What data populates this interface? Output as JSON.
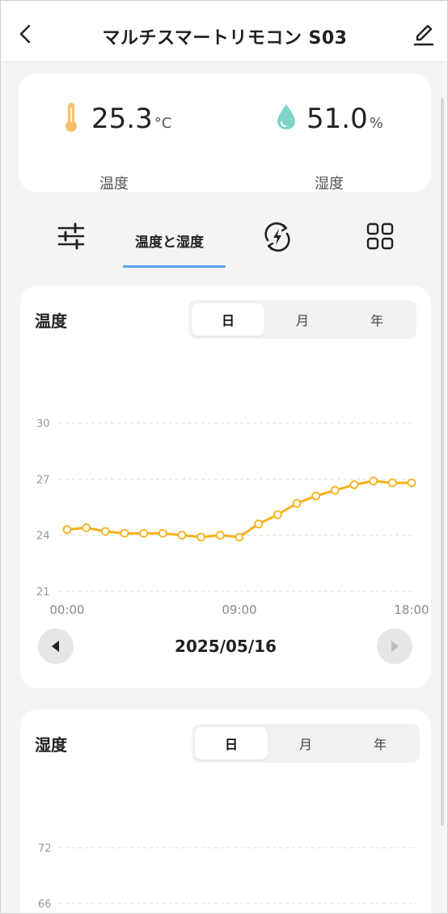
{
  "header": {
    "title": "マルチスマートリモコン S03",
    "back_icon": "chevron-left-icon",
    "edit_icon": "pencil-icon"
  },
  "stats": {
    "temperature": {
      "value": "25.3",
      "unit": "°C",
      "label": "温度",
      "icon": "thermometer-icon",
      "color": "#f5c26b"
    },
    "humidity": {
      "value": "51.0",
      "unit": "%",
      "label": "湿度",
      "icon": "water-drop-icon",
      "color": "#7fd6c8"
    }
  },
  "tabs": [
    {
      "icon": "sliders-icon"
    },
    {
      "label": "温度と湿度",
      "active": true
    },
    {
      "icon": "energy-cycle-icon"
    },
    {
      "icon": "grid-icon"
    }
  ],
  "segments": {
    "day": "日",
    "month": "月",
    "year": "年"
  },
  "temperature_chart": {
    "title": "温度",
    "date": "2025/05/16",
    "prev_icon": "triangle-left-icon",
    "next_icon": "triangle-right-icon"
  },
  "humidity_chart": {
    "title": "湿度"
  },
  "colors": {
    "accent": "#5aa3ef",
    "line": "#f1b21a"
  },
  "chart_data": [
    {
      "type": "line",
      "title": "温度",
      "xlabel": "",
      "ylabel": "",
      "x_ticks": [
        "00:00",
        "09:00",
        "18:00"
      ],
      "y_ticks": [
        21,
        24,
        27,
        30
      ],
      "ylim": [
        21,
        30
      ],
      "grid": true,
      "series": [
        {
          "x": [
            0,
            1,
            2,
            3,
            4,
            5,
            6,
            7,
            8,
            9,
            10,
            11,
            12,
            13,
            14,
            15,
            16,
            17,
            18
          ],
          "values": [
            24.3,
            24.4,
            24.2,
            24.1,
            24.1,
            24.1,
            24.0,
            23.9,
            24.0,
            23.9,
            24.6,
            25.1,
            25.7,
            26.1,
            26.4,
            26.7,
            26.9,
            26.8,
            26.8
          ]
        }
      ]
    },
    {
      "type": "line",
      "title": "湿度",
      "xlabel": "",
      "ylabel": "",
      "y_ticks": [
        66,
        72
      ],
      "grid": true,
      "series": []
    }
  ]
}
